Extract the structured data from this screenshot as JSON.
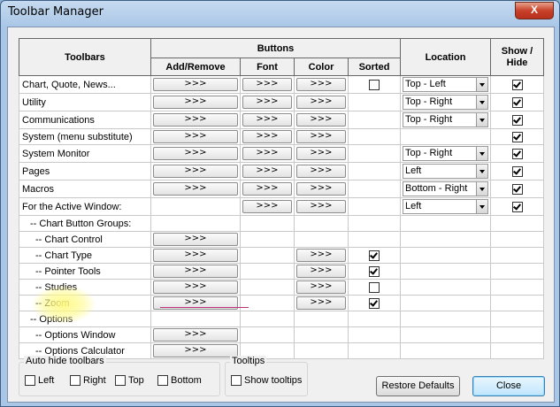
{
  "window": {
    "title": "Toolbar Manager",
    "close_glyph": "X"
  },
  "headers": {
    "toolbars": "Toolbars",
    "buttons": "Buttons",
    "add_remove": "Add/Remove",
    "font": "Font",
    "color": "Color",
    "sorted": "Sorted",
    "location": "Location",
    "show_hide": "Show / Hide"
  },
  "arrow_label": ">>>",
  "rows": [
    {
      "name": "Chart, Quote, News...",
      "add": true,
      "font": true,
      "color": true,
      "sorted": "unchecked",
      "location": "Top - Left",
      "show": true
    },
    {
      "name": "Utility",
      "add": true,
      "font": true,
      "color": true,
      "sorted": null,
      "location": "Top - Right",
      "show": true
    },
    {
      "name": "Communications",
      "add": true,
      "font": true,
      "color": true,
      "sorted": null,
      "location": "Top - Right",
      "show": true
    },
    {
      "name": "System (menu substitute)",
      "add": true,
      "font": true,
      "color": true,
      "sorted": null,
      "location": null,
      "show": true
    },
    {
      "name": "System Monitor",
      "add": true,
      "font": true,
      "color": true,
      "sorted": null,
      "location": "Top - Right",
      "show": true
    },
    {
      "name": "Pages",
      "add": true,
      "font": true,
      "color": true,
      "sorted": null,
      "location": "Left",
      "show": true
    },
    {
      "name": "Macros",
      "add": true,
      "font": true,
      "color": true,
      "sorted": null,
      "location": "Bottom - Right",
      "show": true
    },
    {
      "name": "For the Active Window:",
      "add": false,
      "font": true,
      "color": true,
      "sorted": null,
      "location": "Left",
      "show": true
    },
    {
      "name": "-- Chart Button Groups:",
      "indent": 1,
      "add": false,
      "font": false,
      "color": false,
      "sorted": null,
      "location": null,
      "show": null
    },
    {
      "name": "-- Chart Control",
      "indent": 2,
      "add": true,
      "font": false,
      "color": false,
      "sorted": null,
      "location": null,
      "show": null
    },
    {
      "name": "-- Chart Type",
      "indent": 2,
      "add": true,
      "font": false,
      "color": true,
      "sorted": "checked",
      "location": null,
      "show": null
    },
    {
      "name": "-- Pointer Tools",
      "indent": 2,
      "add": true,
      "font": false,
      "color": true,
      "sorted": "checked",
      "location": null,
      "show": null
    },
    {
      "name": "-- Studies",
      "indent": 2,
      "add": true,
      "font": false,
      "color": true,
      "sorted": "unchecked",
      "location": null,
      "show": null
    },
    {
      "name": "-- Zoom",
      "indent": 2,
      "add": true,
      "font": false,
      "color": true,
      "sorted": "checked",
      "location": null,
      "show": null
    },
    {
      "name": "-- Options",
      "indent": 1,
      "add": false,
      "font": false,
      "color": false,
      "sorted": null,
      "location": null,
      "show": null
    },
    {
      "name": "-- Options Window",
      "indent": 2,
      "add": true,
      "font": false,
      "color": false,
      "sorted": null,
      "location": null,
      "show": null
    },
    {
      "name": "-- Options Calculator",
      "indent": 2,
      "add": true,
      "font": false,
      "color": false,
      "sorted": null,
      "location": null,
      "show": null
    }
  ],
  "autohide": {
    "label": "Auto hide toolbars",
    "left": "Left",
    "right": "Right",
    "top": "Top",
    "bottom": "Bottom"
  },
  "tooltips": {
    "label": "Tooltips",
    "show": "Show tooltips"
  },
  "buttons": {
    "restore": "Restore Defaults",
    "close": "Close"
  }
}
